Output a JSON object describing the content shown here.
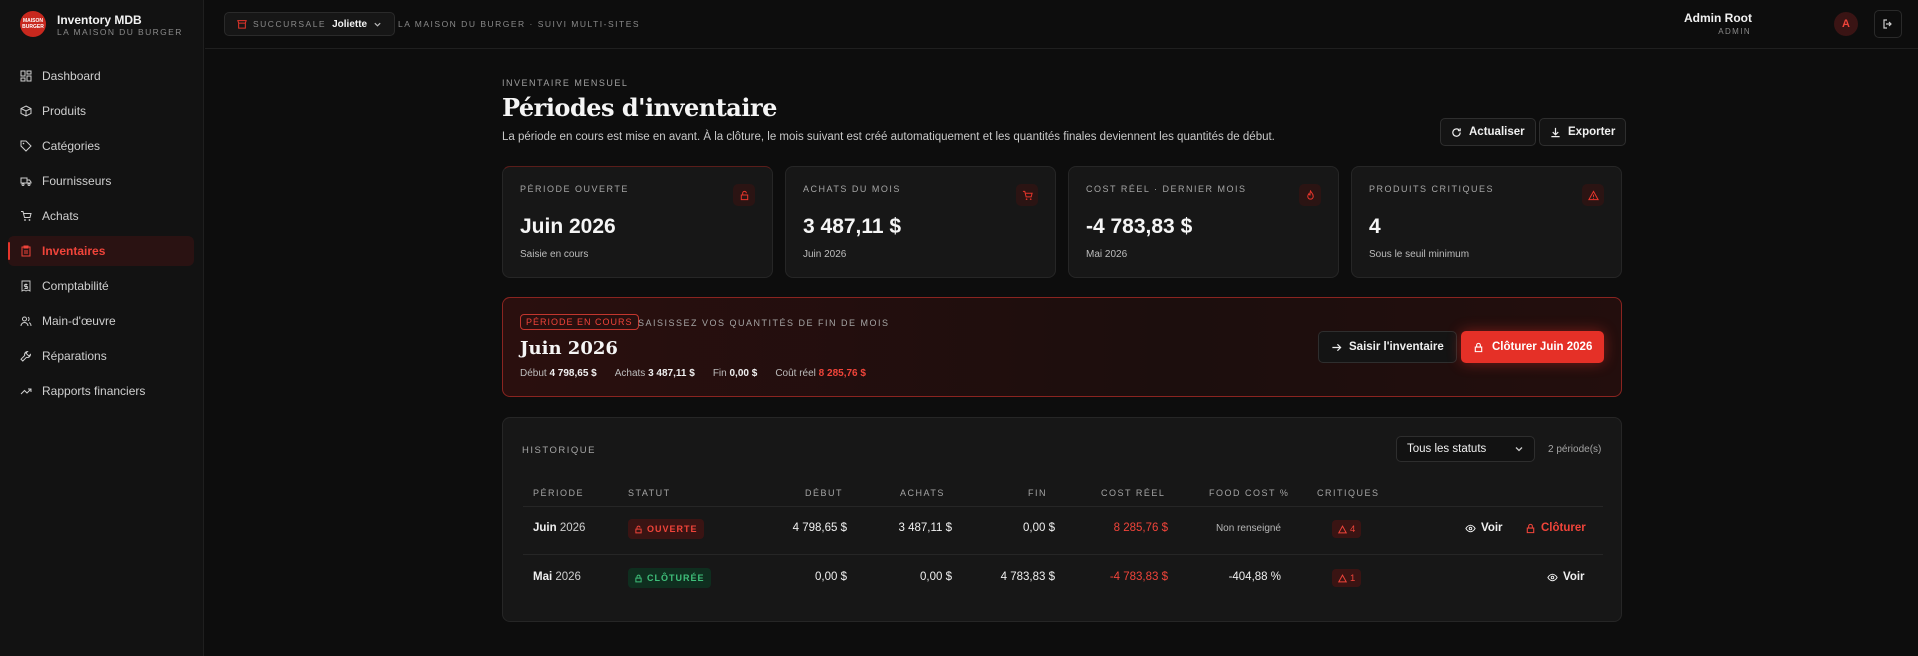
{
  "app": {
    "title": "Inventory MDB",
    "subtitle": "LA MAISON DU BURGER",
    "logo_text": "MAISON BURGER"
  },
  "topbar": {
    "branch_label": "SUCCURSALE",
    "branch_value": "Joliette",
    "tagline": "LA MAISON DU BURGER · SUIVI MULTI-SITES",
    "user_name": "Admin Root",
    "user_role": "ADMIN",
    "avatar_initial": "A"
  },
  "sidebar": {
    "items": [
      {
        "label": "Dashboard",
        "icon": "dashboard-icon"
      },
      {
        "label": "Produits",
        "icon": "box-icon"
      },
      {
        "label": "Catégories",
        "icon": "tag-icon"
      },
      {
        "label": "Fournisseurs",
        "icon": "truck-icon"
      },
      {
        "label": "Achats",
        "icon": "cart-icon"
      },
      {
        "label": "Inventaires",
        "icon": "clipboard-icon",
        "active": true
      },
      {
        "label": "Comptabilité",
        "icon": "receipt-icon"
      },
      {
        "label": "Main-d'œuvre",
        "icon": "users-icon"
      },
      {
        "label": "Réparations",
        "icon": "wrench-icon"
      },
      {
        "label": "Rapports financiers",
        "icon": "trending-icon"
      }
    ]
  },
  "page": {
    "eyebrow": "INVENTAIRE MENSUEL",
    "title": "Périodes d'inventaire",
    "description": "La période en cours est mise en avant. À la clôture, le mois suivant est créé automatiquement et les quantités finales deviennent les quantités de début.",
    "refresh_label": "Actualiser",
    "export_label": "Exporter"
  },
  "cards": [
    {
      "label": "PÉRIODE OUVERTE",
      "value": "Juin 2026",
      "sub": "Saisie en cours",
      "icon": "lock-open-icon"
    },
    {
      "label": "ACHATS DU MOIS",
      "value": "3 487,11 $",
      "sub": "Juin 2026",
      "icon": "cart-icon"
    },
    {
      "label": "COST RÉEL · DERNIER MOIS",
      "value": "-4 783,83 $",
      "sub": "Mai 2026",
      "icon": "flame-icon"
    },
    {
      "label": "PRODUITS CRITIQUES",
      "value": "4",
      "sub": "Sous le seuil minimum",
      "icon": "warning-icon"
    }
  ],
  "current": {
    "badge": "PÉRIODE EN COURS",
    "hint": "SAISISSEZ VOS QUANTITÉS DE FIN DE MOIS",
    "title": "Juin 2026",
    "start_label": "Début",
    "start_value": "4 798,65 $",
    "purchases_label": "Achats",
    "purchases_value": "3 487,11 $",
    "end_label": "Fin",
    "end_value": "0,00 $",
    "cost_label": "Coût réel",
    "cost_value": "8 285,76 $",
    "enter_label": "Saisir l'inventaire",
    "close_label": "Clôturer Juin 2026"
  },
  "history": {
    "title": "HISTORIQUE",
    "filter_value": "Tous les statuts",
    "count": "2 période(s)",
    "columns": [
      "PÉRIODE",
      "STATUT",
      "DÉBUT",
      "ACHATS",
      "FIN",
      "COST RÉEL",
      "FOOD COST %",
      "CRITIQUES"
    ],
    "rows": [
      {
        "month": "Juin",
        "year": "2026",
        "status": "OUVERTE",
        "start": "4 798,65 $",
        "purchases": "3 487,11 $",
        "end": "0,00 $",
        "cost": "8 285,76 $",
        "food_cost": "Non renseigné",
        "critical": "4",
        "view_label": "Voir",
        "close_label": "Clôturer"
      },
      {
        "month": "Mai",
        "year": "2026",
        "status": "CLÔTURÉE",
        "start": "0,00 $",
        "purchases": "0,00 $",
        "end": "4 783,83 $",
        "cost": "-4 783,83 $",
        "food_cost": "-404,88 %",
        "critical": "1",
        "view_label": "Voir"
      }
    ]
  },
  "colors": {
    "accent": "#e53027",
    "success": "#3fbf7a",
    "background": "#0d0d0d",
    "panel": "#171717"
  }
}
